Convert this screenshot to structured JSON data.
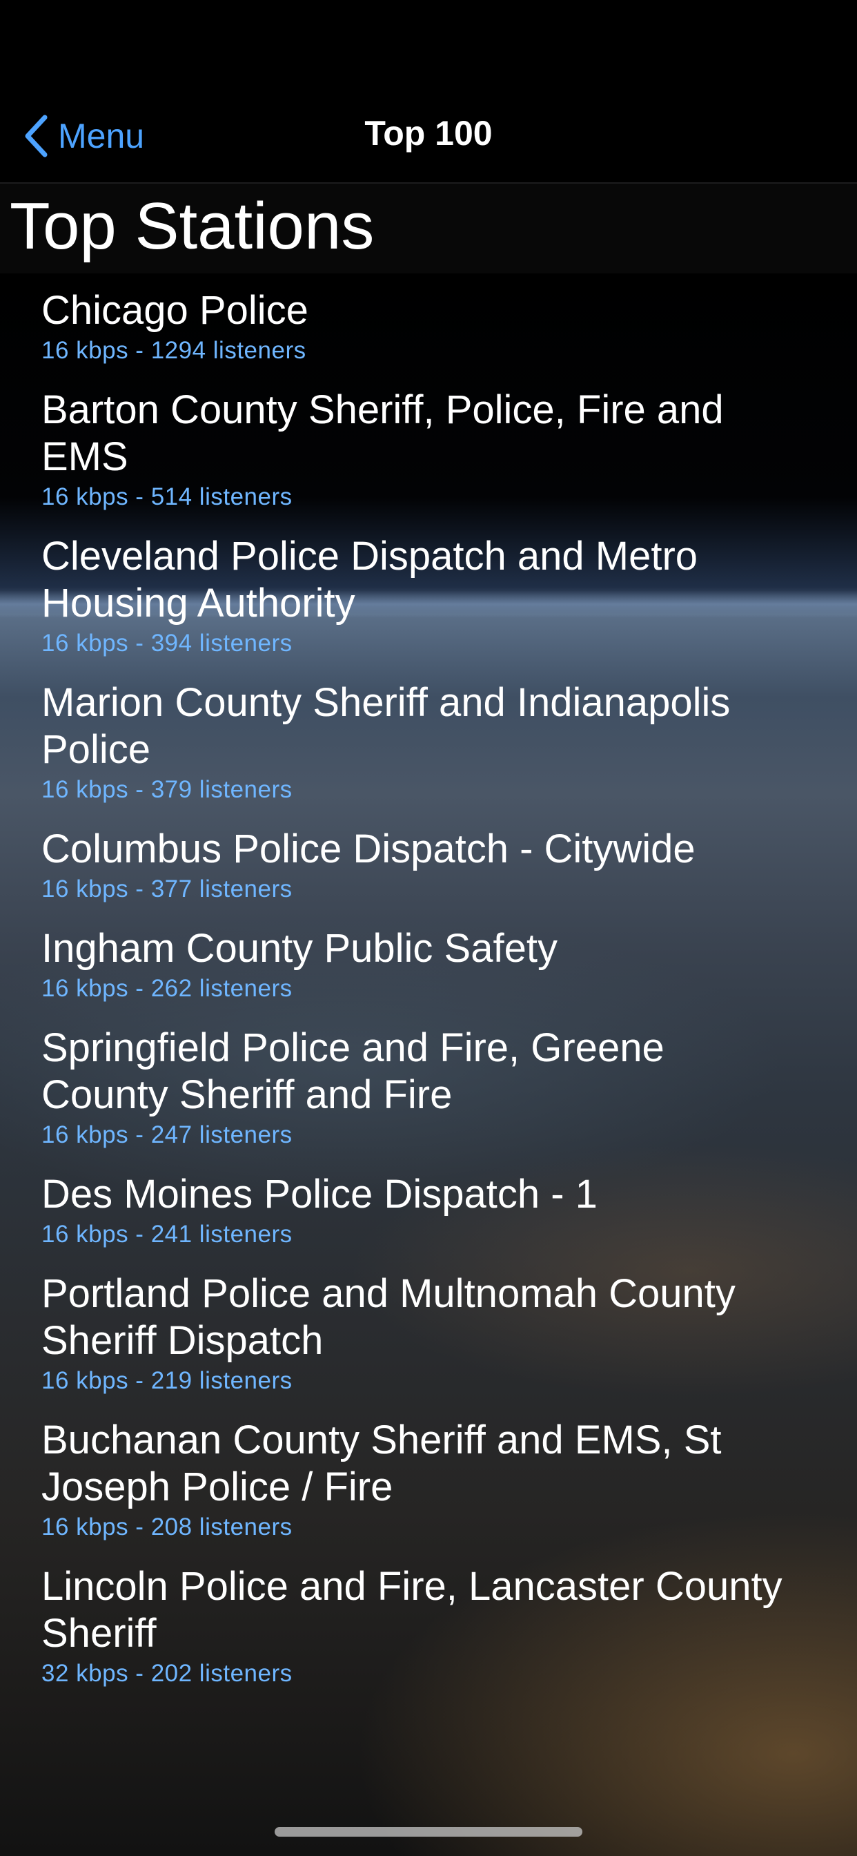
{
  "nav": {
    "back_label": "Menu",
    "title": "Top 100"
  },
  "page": {
    "large_title": "Top Stations"
  },
  "stations": [
    {
      "name": "Chicago Police",
      "info": "16 kbps - 1294 listeners"
    },
    {
      "name": "Barton County Sheriff, Police, Fire and EMS",
      "info": "16 kbps - 514 listeners"
    },
    {
      "name": "Cleveland Police Dispatch and Metro Housing Authority",
      "info": "16 kbps - 394 listeners"
    },
    {
      "name": "Marion County Sheriff and Indianapolis Police",
      "info": "16 kbps - 379 listeners"
    },
    {
      "name": "Columbus Police Dispatch - Citywide",
      "info": "16 kbps - 377 listeners"
    },
    {
      "name": "Ingham County Public Safety",
      "info": "16 kbps - 262 listeners"
    },
    {
      "name": "Springfield Police and Fire, Greene County Sheriff and Fire",
      "info": "16 kbps - 247 listeners"
    },
    {
      "name": "Des Moines Police Dispatch - 1",
      "info": "16 kbps - 241 listeners"
    },
    {
      "name": "Portland Police and Multnomah County Sheriff Dispatch",
      "info": "16 kbps - 219 listeners"
    },
    {
      "name": "Buchanan County Sheriff and EMS, St Joseph Police / Fire",
      "info": "16 kbps - 208 listeners"
    },
    {
      "name": "Lincoln Police and Fire, Lancaster County Sheriff",
      "info": "32 kbps - 202 listeners"
    }
  ],
  "colors": {
    "accent": "#4da3ff",
    "subtitle": "#6fb6ff",
    "text": "#ffffff",
    "background": "#000000"
  },
  "icons": {
    "back": "chevron-left-icon"
  }
}
